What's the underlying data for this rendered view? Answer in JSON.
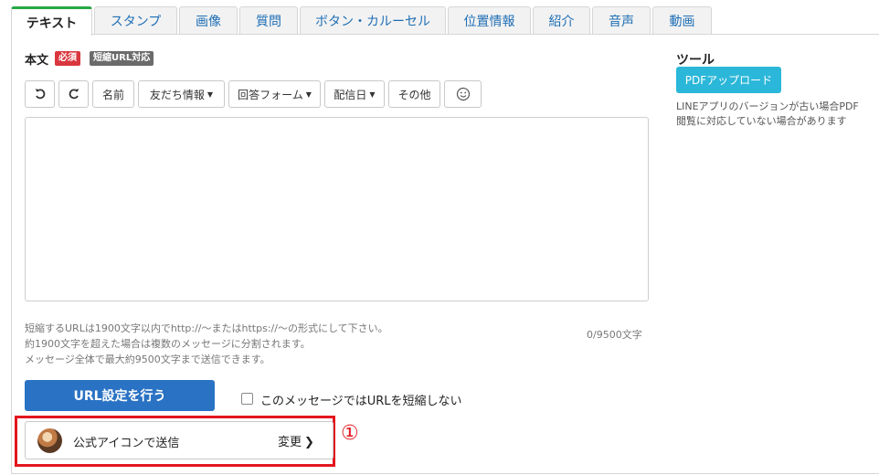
{
  "tabs": [
    {
      "label": "テキスト",
      "active": true
    },
    {
      "label": "スタンプ"
    },
    {
      "label": "画像"
    },
    {
      "label": "質問"
    },
    {
      "label": "ボタン・カルーセル"
    },
    {
      "label": "位置情報"
    },
    {
      "label": "紹介"
    },
    {
      "label": "音声"
    },
    {
      "label": "動画"
    }
  ],
  "body": {
    "label": "本文",
    "required_badge": "必須",
    "short_url_badge": "短縮URL対応"
  },
  "toolbar": {
    "undo_icon": "undo-icon",
    "redo_icon": "redo-icon",
    "name": "名前",
    "friend_info": "友だち情報",
    "answer_form": "回答フォーム",
    "delivery_date": "配信日",
    "other": "その他",
    "emoji_icon": "smiley-icon"
  },
  "help": {
    "line1": "短縮するURLは1900文字以内でhttp://〜またはhttps://〜の形式にして下さい。",
    "line2": "約1900文字を超えた場合は複数のメッセージに分割されます。",
    "line3": "メッセージ全体で最大約9500文字まで送信できます。",
    "counter": "0/9500文字"
  },
  "url_button": "URL設定を行う",
  "no_shorten_label": "このメッセージではURLを短縮しない",
  "no_shorten_checked": false,
  "sender": {
    "label": "公式アイコンで送信",
    "change": "変更",
    "annotation": "①"
  },
  "tools": {
    "title": "ツール",
    "pdf_button": "PDFアップロード",
    "note": "LINEアプリのバージョンが古い場合PDF閲覧に対応していない場合があります"
  },
  "colors": {
    "active_tab_accent": "#27a745",
    "tab_link": "#1f6fb5",
    "primary_button": "#2a72c4",
    "pdf_button": "#2bb7d9",
    "required_badge": "#d9363e",
    "highlight": "#e3161d"
  }
}
